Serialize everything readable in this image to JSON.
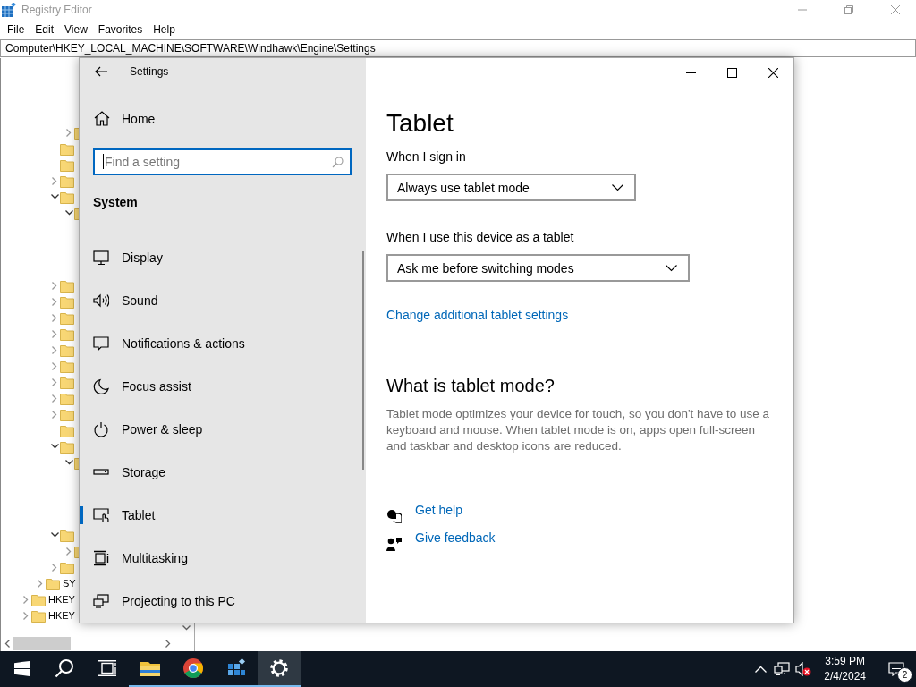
{
  "registry_editor": {
    "title": "Registry Editor",
    "menu": [
      "File",
      "Edit",
      "View",
      "Favorites",
      "Help"
    ],
    "address": "Computer\\HKEY_LOCAL_MACHINE\\SOFTWARE\\Windhawk\\Engine\\Settings",
    "tree": {
      "top_rows": [
        {
          "has_children": true,
          "expanded": false
        }
      ],
      "branch": [
        {
          "has_children": false
        },
        {
          "has_children": false
        },
        {
          "has_children": true,
          "expanded": false
        },
        {
          "has_children": true,
          "expanded": true,
          "children": [
            {
              "has_children": true,
              "expanded": true
            }
          ]
        },
        {
          "has_children": true,
          "expanded": false
        },
        {
          "has_children": true,
          "expanded": false
        },
        {
          "has_children": true,
          "expanded": false
        },
        {
          "has_children": true,
          "expanded": false
        },
        {
          "has_children": true,
          "expanded": false
        },
        {
          "has_children": true,
          "expanded": false
        },
        {
          "has_children": true,
          "expanded": false
        },
        {
          "has_children": true,
          "expanded": false
        },
        {
          "has_children": true,
          "expanded": false
        },
        {
          "has_children": false
        },
        {
          "has_children": true,
          "expanded": true,
          "children": [
            {
              "has_children": true,
              "expanded": true
            }
          ]
        },
        {
          "has_children": true,
          "expanded": true,
          "children": [
            {
              "has_children": true,
              "expanded": false
            }
          ]
        },
        {
          "has_children": true,
          "expanded": false
        }
      ],
      "sibling_keys": [
        {
          "label": "SY",
          "has_children": true,
          "expanded": false
        }
      ],
      "root_keys": [
        {
          "label": "HKEY",
          "has_children": true,
          "expanded": false
        },
        {
          "label": "HKEY",
          "has_children": true,
          "expanded": false
        }
      ]
    }
  },
  "settings": {
    "title": "Settings",
    "home": "Home",
    "search": {
      "placeholder": "Find a setting",
      "focused": true
    },
    "section": "System",
    "nav_items": [
      {
        "label": "Display",
        "selected": false
      },
      {
        "label": "Sound",
        "selected": false
      },
      {
        "label": "Notifications & actions",
        "selected": false
      },
      {
        "label": "Focus assist",
        "selected": false
      },
      {
        "label": "Power & sleep",
        "selected": false
      },
      {
        "label": "Storage",
        "selected": false
      },
      {
        "label": "Tablet",
        "selected": true
      },
      {
        "label": "Multitasking",
        "selected": false
      },
      {
        "label": "Projecting to this PC",
        "selected": false
      }
    ],
    "page_title": "Tablet",
    "dropdowns": [
      {
        "label": "When I sign in",
        "value": "Always use tablet mode"
      },
      {
        "label": "When I use this device as a tablet",
        "value": "Ask me before switching modes"
      }
    ],
    "link": "Change additional tablet settings",
    "info_title": "What is tablet mode?",
    "info_text": "Tablet mode optimizes your device for touch, so you don't have to use a keyboard and mouse. When tablet mode is on, apps open full-screen and taskbar and desktop icons are reduced.",
    "help_links": [
      "Get help",
      "Give feedback"
    ]
  },
  "taskbar": {
    "apps": [
      {
        "running": true,
        "selected": false
      },
      {
        "running": true,
        "selected": false
      },
      {
        "running": true,
        "selected": false
      },
      {
        "running": true,
        "selected": true
      }
    ],
    "time": "3:59 PM",
    "date": "2/4/2024",
    "notification_count": "2"
  }
}
